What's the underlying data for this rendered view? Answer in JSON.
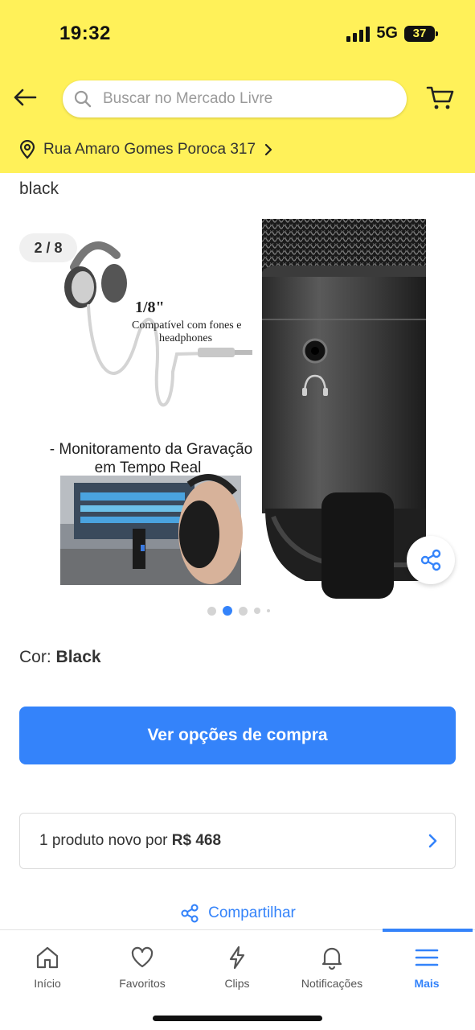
{
  "status_bar": {
    "time": "19:32",
    "network": "5G",
    "battery": "37"
  },
  "header": {
    "search_placeholder": "Buscar no Mercado Livre",
    "address": "Rua Amaro Gomes Poroca 317"
  },
  "product": {
    "title_fragment": "black",
    "gallery": {
      "counter": "2 / 8",
      "image": {
        "jack_label": "1/8\"",
        "compat_line1": "Compatível com fones e",
        "compat_line2": "headphones",
        "caption_line1": "- Monitoramento da Gravação",
        "caption_line2": "em Tempo Real"
      },
      "active_dot": 1,
      "dot_count": 5
    },
    "color_label": "Cor:",
    "color_value": "Black",
    "buy_button": "Ver opções de compra",
    "offer_text": "1 produto novo por",
    "offer_price": "R$ 468",
    "share_label": "Compartilhar"
  },
  "tabbar": {
    "items": [
      {
        "label": "Início",
        "icon": "home-icon"
      },
      {
        "label": "Favoritos",
        "icon": "heart-icon"
      },
      {
        "label": "Clips",
        "icon": "lightning-icon"
      },
      {
        "label": "Notificações",
        "icon": "bell-icon"
      },
      {
        "label": "Mais",
        "icon": "menu-icon"
      }
    ],
    "active_index": 4
  },
  "colors": {
    "header_yellow": "#fff159",
    "accent_blue": "#3483fa"
  }
}
